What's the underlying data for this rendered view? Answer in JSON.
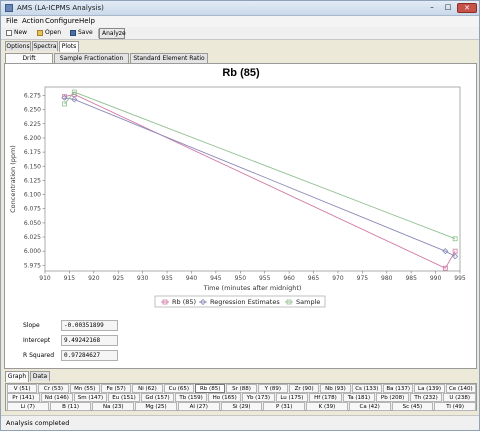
{
  "window": {
    "title": "AMS (LA-ICPMS Analysis)",
    "minimize": "–",
    "maximize": "□",
    "close": "✕"
  },
  "menu": [
    "File",
    "Action",
    "Configure",
    "Help"
  ],
  "toolbar": {
    "new_label": "New",
    "open_label": "Open",
    "save_label": "Save",
    "analyze_label": "Analyze"
  },
  "top_tabs": [
    "Options",
    "Spectra",
    "Plots"
  ],
  "sub_tabs": [
    "Drift Correction",
    "Sample Fractionation Plots",
    "Standard Element Ratio Plots"
  ],
  "chart_data": {
    "type": "line",
    "title": "Rb (85)",
    "xlabel": "Time (minutes after midnight)",
    "ylabel": "Concentration (ppm)",
    "xlim": [
      910,
      995
    ],
    "ylim": [
      5.965,
      6.29
    ],
    "x_ticks": [
      910,
      915,
      920,
      925,
      930,
      935,
      940,
      945,
      950,
      955,
      960,
      965,
      970,
      975,
      980,
      985,
      990,
      995
    ],
    "y_ticks": [
      5.975,
      6.0,
      6.025,
      6.05,
      6.075,
      6.1,
      6.125,
      6.15,
      6.175,
      6.2,
      6.225,
      6.25,
      6.275
    ],
    "y_tick_labels": [
      "5.975",
      "6.000",
      "6.025",
      "6.050",
      "6.075",
      "6.100",
      "6.125",
      "6.150",
      "6.175",
      "6.200",
      "6.225",
      "6.250",
      "6.275"
    ],
    "legend_position": "bottom-center",
    "grid": false,
    "series": [
      {
        "name": "Rb (85)",
        "color": "#d07aa6",
        "marker": "square",
        "points": [
          [
            914,
            6.273
          ],
          [
            916,
            6.277
          ],
          [
            992,
            5.97
          ],
          [
            994,
            6.0
          ]
        ]
      },
      {
        "name": "Regression Estimates",
        "color": "#8a8ab8",
        "marker": "diamond",
        "points": [
          [
            914,
            6.271
          ],
          [
            916,
            6.268
          ],
          [
            992,
            6.0
          ],
          [
            994,
            5.991
          ]
        ]
      },
      {
        "name": "Sample",
        "color": "#8fbf8f",
        "marker": "square",
        "points": [
          [
            914,
            6.26
          ],
          [
            916,
            6.281
          ],
          [
            994,
            6.022
          ]
        ]
      }
    ]
  },
  "stats": [
    {
      "label": "Slope",
      "value": "-0.00351899"
    },
    {
      "label": "Intercept",
      "value": "9.49242168"
    },
    {
      "label": "R Squared",
      "value": "0.97284627"
    }
  ],
  "bottom_tabs": [
    "Graph",
    "Data"
  ],
  "elements": [
    [
      "V (51)",
      "Cr (53)",
      "Mn (55)",
      "Fe (57)",
      "Ni (62)",
      "Cu (65)",
      "Rb (85)",
      "Sr (88)",
      "Y (89)",
      "Zr (90)",
      "Nb (93)",
      "Cs (133)",
      "Ba (137)",
      "La (139)",
      "Ce (140)"
    ],
    [
      "Pr (141)",
      "Nd (146)",
      "Sm (147)",
      "Eu (151)",
      "Gd (157)",
      "Tb (159)",
      "Ho (165)",
      "Yb (173)",
      "Lu (175)",
      "Hf (178)",
      "Ta (181)",
      "Pb (208)",
      "Th (232)",
      "U (238)"
    ],
    [
      "Li (7)",
      "B (11)",
      "Na (23)",
      "Mg (25)",
      "Al (27)",
      "Si (29)",
      "P (31)",
      "K (39)",
      "Ca (42)",
      "Sc (45)",
      "Ti (49)"
    ]
  ],
  "selected_element": "Rb (85)",
  "status": "Analysis completed"
}
